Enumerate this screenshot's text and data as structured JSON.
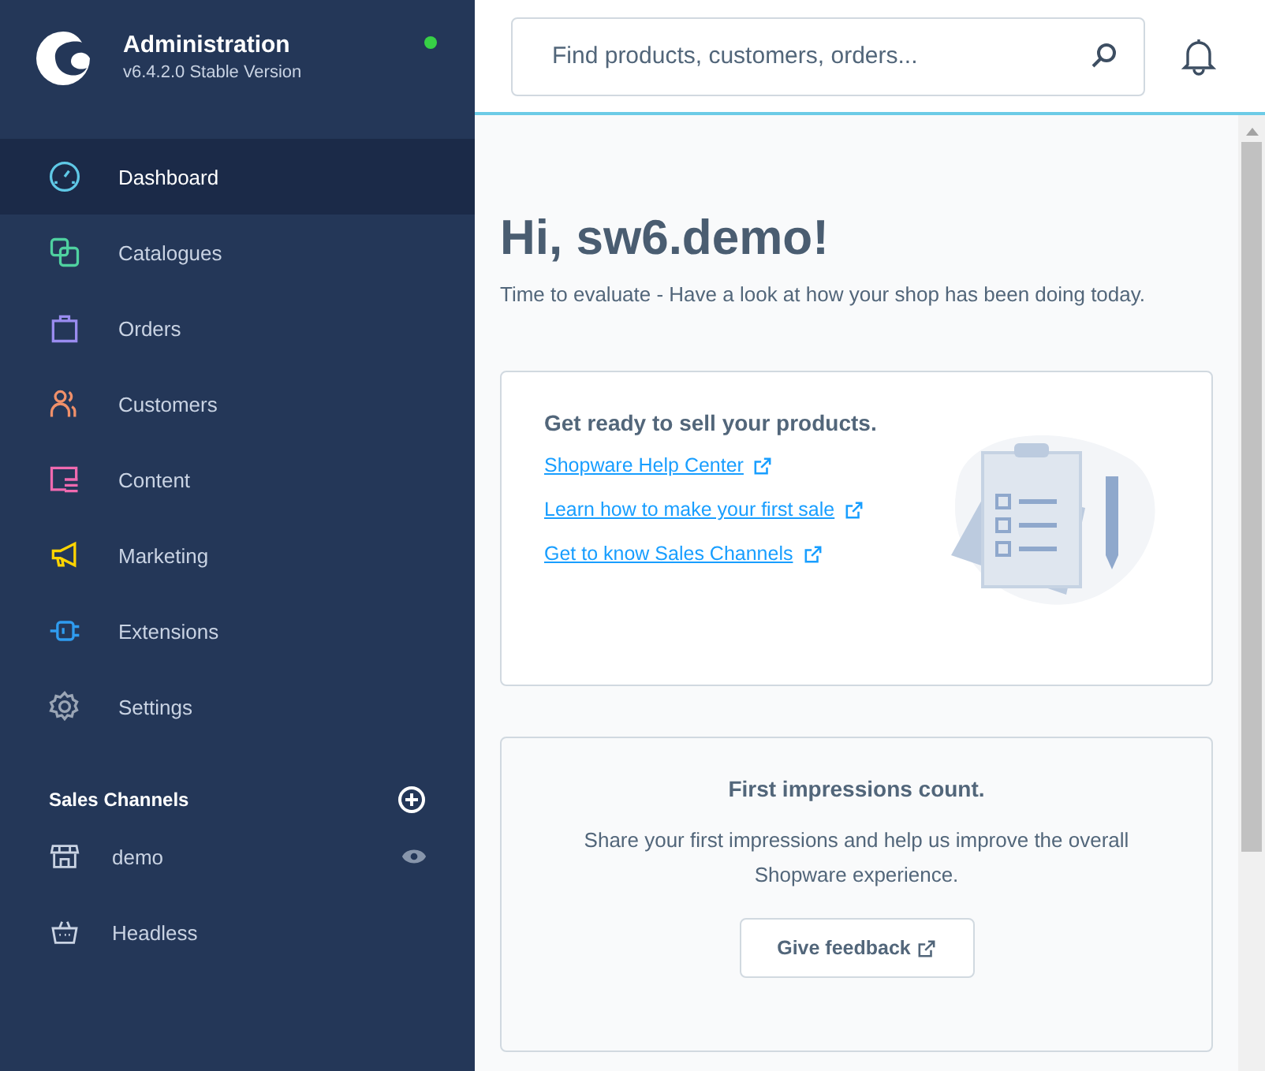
{
  "app": {
    "title": "Administration",
    "version": "v6.4.2.0 Stable Version",
    "online": true
  },
  "nav": [
    {
      "kind": "dashboard",
      "label": "Dashboard",
      "color": "#5fc8e6",
      "selected": true
    },
    {
      "kind": "catalogues",
      "label": "Catalogues",
      "color": "#4fd1a0",
      "selected": false
    },
    {
      "kind": "orders",
      "label": "Orders",
      "color": "#9a8cf0",
      "selected": false
    },
    {
      "kind": "customers",
      "label": "Customers",
      "color": "#f0906a",
      "selected": false
    },
    {
      "kind": "content",
      "label": "Content",
      "color": "#f06ab0",
      "selected": false
    },
    {
      "kind": "marketing",
      "label": "Marketing",
      "color": "#ffd400",
      "selected": false
    },
    {
      "kind": "extensions",
      "label": "Extensions",
      "color": "#2f9cf0",
      "selected": false
    },
    {
      "kind": "settings",
      "label": "Settings",
      "color": "#9aa5b5",
      "selected": false
    }
  ],
  "sales_channels": {
    "title": "Sales Channels",
    "items": [
      {
        "kind": "storefront",
        "label": "demo",
        "hovered": true
      },
      {
        "kind": "headless",
        "label": "Headless",
        "hovered": false
      }
    ]
  },
  "search": {
    "placeholder": "Find products, customers, orders..."
  },
  "greeting": {
    "title": "Hi, sw6.demo!",
    "subtitle": "Time to evaluate - Have a look at how your shop has been doing today."
  },
  "ready_card": {
    "title": "Get ready to sell your products.",
    "links": [
      "Shopware Help Center",
      "Learn how to make your first sale",
      "Get to know Sales Channels"
    ]
  },
  "feedback_card": {
    "title": "First impressions count.",
    "text": "Share your first impressions and help us improve the overall Shopware experience.",
    "button": "Give feedback"
  }
}
